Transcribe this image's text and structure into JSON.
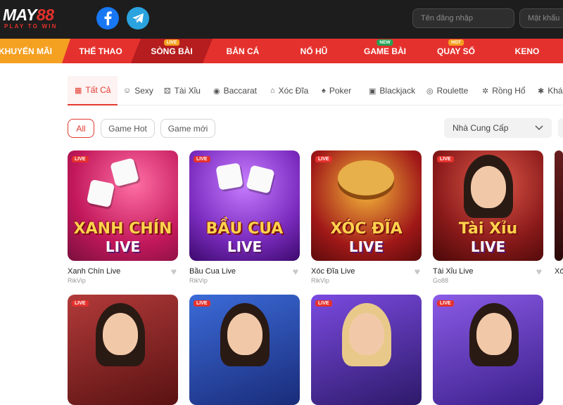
{
  "header": {
    "logo_text_a": "MAY",
    "logo_text_b": "88",
    "logo_tagline": "PLAY TO WIN",
    "username_placeholder": "Tên đăng nhập",
    "password_placeholder": "Mật khẩu"
  },
  "nav": {
    "items": [
      {
        "label": "KHUYẾN MÃI"
      },
      {
        "label": "THỂ THAO"
      },
      {
        "label": "SÒNG BÀI",
        "badge": "LIVE"
      },
      {
        "label": "BẮN CÁ"
      },
      {
        "label": "NỔ HŨ"
      },
      {
        "label": "GAME BÀI",
        "badge": "NEW"
      },
      {
        "label": "QUAY SỐ",
        "badge": "HOT"
      },
      {
        "label": "KENO"
      }
    ]
  },
  "categories": [
    {
      "label": "Tất Cả",
      "icon": "grid-icon"
    },
    {
      "label": "Sexy",
      "icon": "girl-icon"
    },
    {
      "label": "Tài Xỉu",
      "icon": "dice-icon"
    },
    {
      "label": "Baccarat",
      "icon": "chips-icon"
    },
    {
      "label": "Xóc Đĩa",
      "icon": "bowl-icon"
    },
    {
      "label": "Poker",
      "icon": "poker-icon"
    },
    {
      "label": "Blackjack",
      "icon": "cards-icon"
    },
    {
      "label": "Roulette",
      "icon": "roulette-icon"
    },
    {
      "label": "Rồng Hổ",
      "icon": "dragon-icon"
    },
    {
      "label": "Khá",
      "icon": "more-icon"
    }
  ],
  "filters": {
    "chips": [
      "All",
      "Game Hot",
      "Game mới"
    ],
    "provider_label": "Nhà Cung Cấp"
  },
  "games": [
    {
      "name": "Xanh Chín Live",
      "provider": "RikVip",
      "tag": "LIVE",
      "art1": "XANH CHÍN",
      "art2": "LIVE"
    },
    {
      "name": "Bầu Cua Live",
      "provider": "RikVip",
      "tag": "LIVE",
      "art1": "BẦU CUA",
      "art2": "LIVE"
    },
    {
      "name": "Xóc Đĩa Live",
      "provider": "RikVip",
      "tag": "LIVE",
      "art1": "XÓC ĐĨA",
      "art2": "LIVE"
    },
    {
      "name": "Tài Xỉu Live",
      "provider": "Go88",
      "tag": "LIVE",
      "art1": "Tài Xỉu",
      "art2": "LIVE"
    },
    {
      "name": "Xó",
      "provider": "",
      "tag": "",
      "art1": "",
      "art2": ""
    }
  ],
  "games_row2": [
    {
      "tag": "LIVE"
    },
    {
      "tag": "LIVE"
    },
    {
      "tag": "LIVE"
    },
    {
      "tag": "LIVE"
    }
  ],
  "colors": {
    "topbar": "#1d1d1d",
    "nav": "#e5312d",
    "nav_promo": "#f4a021",
    "nav_active": "#b51d1e",
    "accent": "#e23a30"
  }
}
